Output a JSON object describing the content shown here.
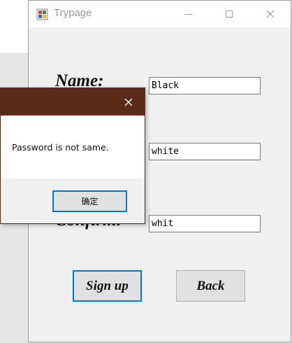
{
  "window": {
    "title": "Trypage"
  },
  "form": {
    "name_label": "Name:",
    "confirm_label": "Confirm:",
    "name_value": "Black",
    "password_value": "white",
    "confirm_value": "whit",
    "signup_label": "Sign up",
    "back_label": "Back"
  },
  "dialog": {
    "message": "Password is not same.",
    "ok_label": "确定"
  },
  "colors": {
    "dialog_title": "#5b2a19",
    "focus_border": "#0078d7"
  }
}
